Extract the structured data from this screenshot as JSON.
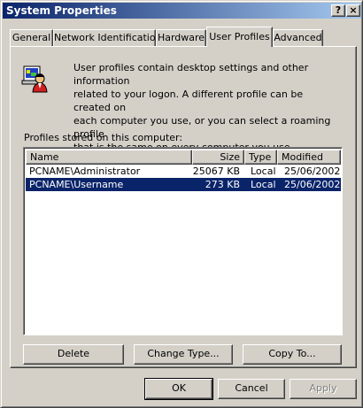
{
  "window": {
    "title": "System Properties",
    "help_label": "?",
    "close_label": "×"
  },
  "tabs": [
    {
      "label": "General",
      "active": false
    },
    {
      "label": "Network Identification",
      "active": false
    },
    {
      "label": "Hardware",
      "active": false
    },
    {
      "label": "User Profiles",
      "active": true
    },
    {
      "label": "Advanced",
      "active": false
    }
  ],
  "user_profiles": {
    "icon": "user-profiles-icon",
    "description_lines": [
      "User profiles contain desktop settings and other information",
      "related to your logon.  A different profile can be created on",
      "each computer you use, or you can select a roaming profile",
      "that is the same on every computer you use."
    ],
    "list_caption": "Profiles stored on this computer:",
    "columns": [
      "Name",
      "Size",
      "Type",
      "Modified"
    ],
    "rows": [
      {
        "name": "PCNAME\\Administrator",
        "size": "25067 KB",
        "type": "Local",
        "modified": "25/06/2002",
        "selected": false
      },
      {
        "name": "PCNAME\\Username",
        "size": "273 KB",
        "type": "Local",
        "modified": "25/06/2002",
        "selected": true
      }
    ],
    "buttons": {
      "delete": "Delete",
      "change_type": "Change Type...",
      "copy_to": "Copy To..."
    }
  },
  "dialog_buttons": {
    "ok": "OK",
    "cancel": "Cancel",
    "apply": "Apply"
  },
  "colors": {
    "selection": "#0a246a",
    "face": "#d4d0c8"
  }
}
